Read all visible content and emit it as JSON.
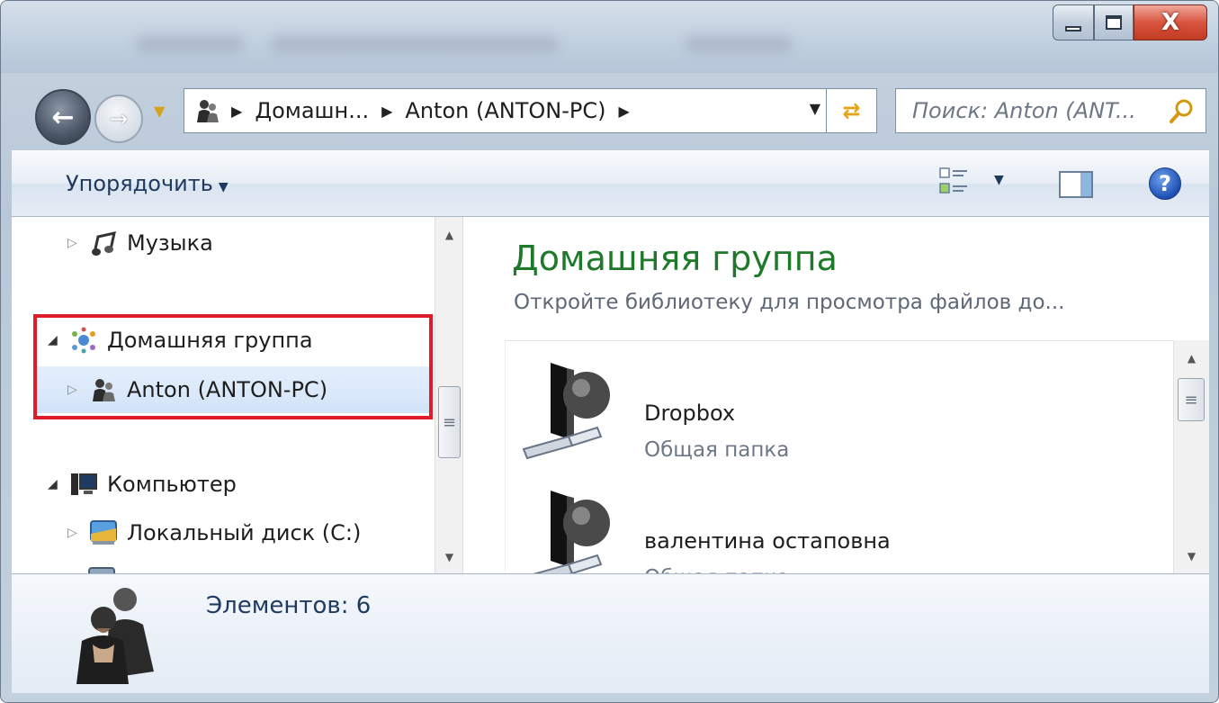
{
  "window": {
    "controls": {
      "minimize_icon": "minimize-icon",
      "maximize_icon": "maximize-icon",
      "close_label": "X"
    }
  },
  "navigation": {
    "back_icon": "back-arrow-icon",
    "forward_icon": "forward-arrow-icon",
    "history_icon": "chevron-down-icon"
  },
  "address_bar": {
    "crumbs": [
      "Домашн...",
      "Anton (ANTON-PC)"
    ],
    "refresh_icon": "refresh-icon"
  },
  "search": {
    "placeholder": "Поиск: Anton (ANT...",
    "icon": "search-icon"
  },
  "toolbar": {
    "organize_label": "Упорядочить",
    "view_icon": "change-view-icon",
    "preview_icon": "preview-pane-icon",
    "help_icon": "help-icon",
    "help_glyph": "?"
  },
  "tree": {
    "items": [
      {
        "label": "Музыка",
        "icon": "music-icon",
        "expander": "collapsed"
      },
      {
        "label": "Домашняя группа",
        "icon": "homegroup-icon",
        "expander": "expanded"
      },
      {
        "label": "Anton (ANTON-PC)",
        "icon": "user-icon",
        "expander": "collapsed",
        "selected": true
      },
      {
        "label": "Компьютер",
        "icon": "computer-icon",
        "expander": "expanded"
      },
      {
        "label": "Локальный диск (C:)",
        "icon": "drive-icon",
        "expander": "collapsed"
      }
    ]
  },
  "main": {
    "title": "Домашняя группа",
    "subtitle": "Откройте библиотеку для просмотра файлов до...",
    "items": [
      {
        "name": "Dropbox",
        "type": "Общая папка",
        "icon": "shared-folder-icon"
      },
      {
        "name": "валентина остаповна",
        "type": "Общая папка",
        "icon": "shared-folder-icon"
      }
    ]
  },
  "status_bar": {
    "text": "Элементов: 6",
    "icon": "users-icon"
  },
  "colors": {
    "title_green": "#1e7a2a",
    "highlight_red": "#e01b2a",
    "link_blue": "#1e3a5f"
  }
}
